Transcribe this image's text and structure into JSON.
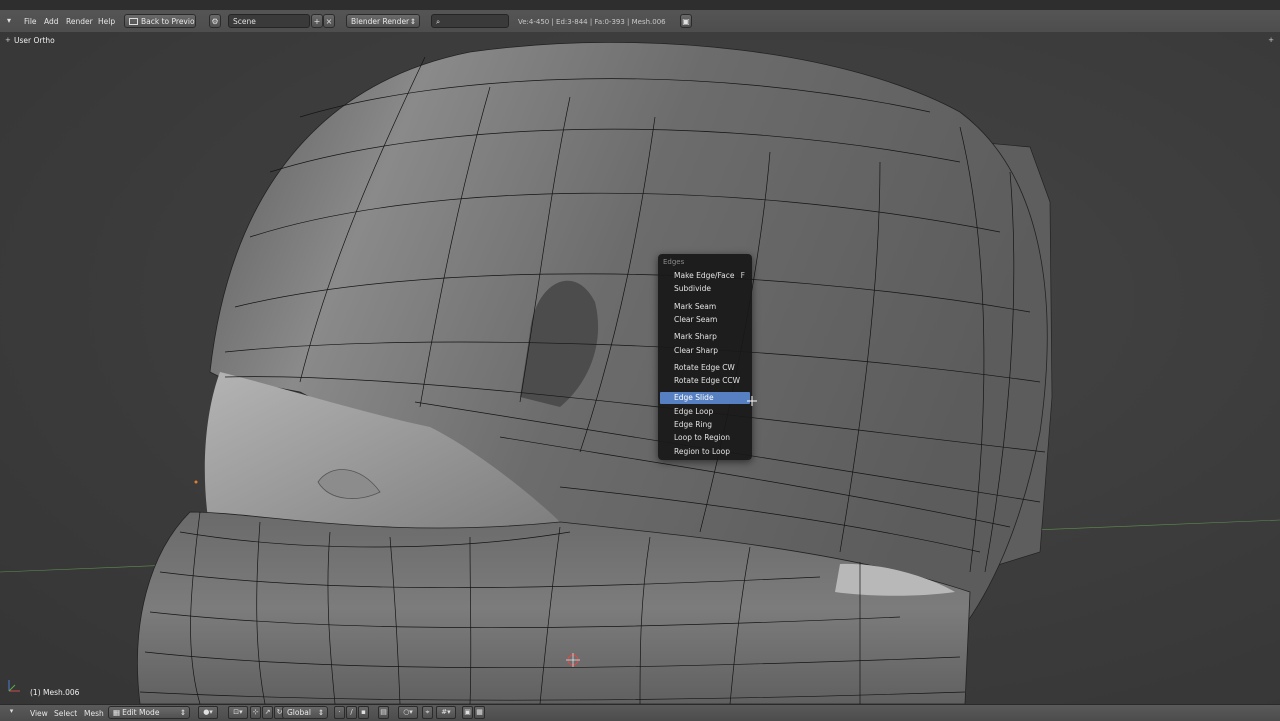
{
  "header": {
    "menu": [
      "File",
      "Add",
      "Render",
      "Help"
    ],
    "back_button": "Back to Previous",
    "scene_field": "Scene",
    "render_engine": "Blender Render",
    "search_placeholder": "",
    "stats": "Ve:4-450 | Ed:3-844 | Fa:0-393 | Mesh.006"
  },
  "viewport": {
    "view_name": "User Ortho",
    "object_info": "(1) Mesh.006"
  },
  "context_menu": {
    "title": "Edges",
    "items": [
      {
        "label": "Make Edge/Face",
        "shortcut": "F"
      },
      {
        "label": "Subdivide",
        "shortcut": ""
      },
      {
        "label": "Mark Seam",
        "shortcut": ""
      },
      {
        "label": "Clear Seam",
        "shortcut": ""
      },
      {
        "label": "Mark Sharp",
        "shortcut": ""
      },
      {
        "label": "Clear Sharp",
        "shortcut": ""
      },
      {
        "label": "Rotate Edge CW",
        "shortcut": ""
      },
      {
        "label": "Rotate Edge CCW",
        "shortcut": ""
      },
      {
        "label": "Edge Slide",
        "shortcut": ""
      },
      {
        "label": "Edge Loop",
        "shortcut": ""
      },
      {
        "label": "Edge Ring",
        "shortcut": ""
      },
      {
        "label": "Loop to Region",
        "shortcut": ""
      },
      {
        "label": "Region to Loop",
        "shortcut": ""
      }
    ],
    "active_item": "Edge Slide"
  },
  "footer": {
    "menu": [
      "View",
      "Select",
      "Mesh"
    ],
    "mode": "Edit Mode",
    "orientation": "Global"
  },
  "colors": {
    "highlight": "#5680c2",
    "viewport_bg": "#3b3b3b",
    "mesh": "#6e6e6e"
  }
}
